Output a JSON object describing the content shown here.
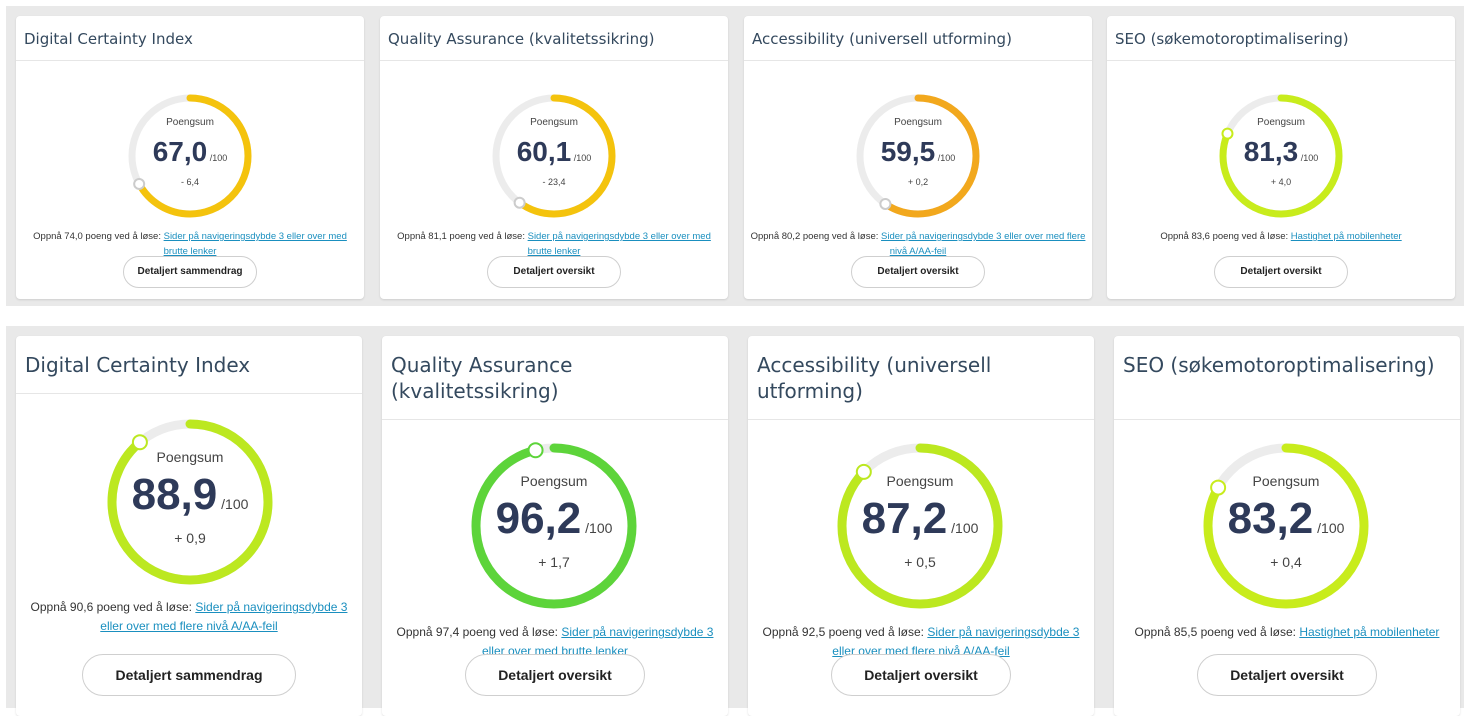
{
  "colors": {
    "track": "#ececec",
    "link": "#1a8fbf",
    "score": "#2e3a59"
  },
  "score_label": "Poengsum",
  "max_label": "/100",
  "reach_prefix_template": "Oppnå {n} poeng ved å løse:",
  "rows": [
    {
      "cards": [
        {
          "title": "Digital Certainty Index",
          "score": "67,0",
          "score_value": 67.0,
          "delta": "- 6,4",
          "arc_color": "#f4c30d",
          "reach_prefix": "Oppnå 74,0 poeng ved å løse:",
          "reach_link": "Sider på navigeringsdybde 3 eller over med brutte lenker",
          "button": "Detaljert sammendrag"
        },
        {
          "title": "Quality Assurance (kvalitetssikring)",
          "score": "60,1",
          "score_value": 60.1,
          "delta": "- 23,4",
          "arc_color": "#f4c30d",
          "reach_prefix": "Oppnå 81,1 poeng ved å løse:",
          "reach_link": "Sider på navigeringsdybde 3 eller over med brutte lenker",
          "button": "Detaljert oversikt"
        },
        {
          "title": "Accessibility (universell utforming)",
          "score": "59,5",
          "score_value": 59.5,
          "delta": "+ 0,2",
          "arc_color": "#f2a81d",
          "reach_prefix": "Oppnå 80,2 poeng ved å løse:",
          "reach_link": "Sider på navigeringsdybde 3 eller over med flere nivå A/AA-feil",
          "button": "Detaljert oversikt"
        },
        {
          "title": "SEO (søkemotoroptimalisering)",
          "score": "81,3",
          "score_value": 81.3,
          "delta": "+ 4,0",
          "arc_color": "#c8ec1c",
          "reach_prefix": "Oppnå 83,6 poeng ved å løse:",
          "reach_link": "Hastighet på mobilenheter",
          "button": "Detaljert oversikt"
        }
      ]
    },
    {
      "cards": [
        {
          "title": "Digital Certainty Index",
          "score": "88,9",
          "score_value": 88.9,
          "delta": "+ 0,9",
          "arc_color": "#bce820",
          "reach_prefix": "Oppnå 90,6 poeng ved å løse:",
          "reach_link": "Sider på navigeringsdybde 3 eller over med flere nivå A/AA-feil",
          "button": "Detaljert sammendrag"
        },
        {
          "title": "Quality Assurance (kvalitetssikring)",
          "score": "96,2",
          "score_value": 96.2,
          "delta": "+ 1,7",
          "arc_color": "#5dd43a",
          "reach_prefix": "Oppnå 97,4 poeng ved å løse:",
          "reach_link": "Sider på navigeringsdybde 3 eller over med brutte lenker",
          "button": "Detaljert oversikt"
        },
        {
          "title": "Accessibility (universell utforming)",
          "score": "87,2",
          "score_value": 87.2,
          "delta": "+ 0,5",
          "arc_color": "#bce820",
          "reach_prefix": "Oppnå 92,5 poeng ved å løse:",
          "reach_link": "Sider på navigeringsdybde 3 eller over med flere nivå A/AA-feil",
          "button": "Detaljert oversikt"
        },
        {
          "title": "SEO (søkemotoroptimalisering)",
          "score": "83,2",
          "score_value": 83.2,
          "delta": "+ 0,4",
          "arc_color": "#c8ec1c",
          "reach_prefix": "Oppnå 85,5 poeng ved å løse:",
          "reach_link": "Hastighet på mobilenheter",
          "button": "Detaljert oversikt"
        }
      ]
    }
  ]
}
